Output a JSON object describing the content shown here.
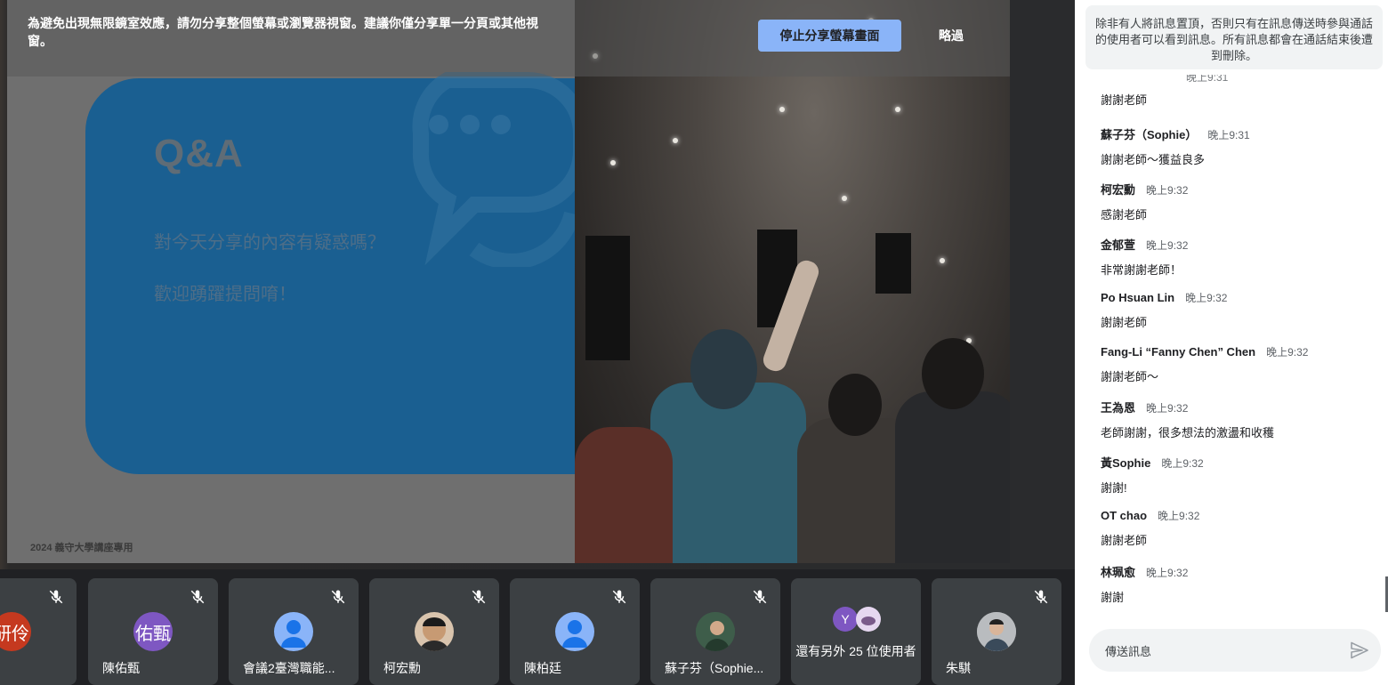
{
  "banner": {
    "warning": "為避免出現無限鏡室效應，請勿分享整個螢幕或瀏覽器視窗。建議你僅分享單一分頁或其他視窗。",
    "stop_share_label": "停止分享螢幕畫面",
    "skip_label": "略過"
  },
  "slide": {
    "title": "Q&A",
    "line1": "對今天分享的內容有疑惑嗎？",
    "line2": "歡迎踴躍提問唷！",
    "footer": "2024 義守大學講座專用",
    "card_color": "#1a5f91"
  },
  "participants": [
    {
      "name": "",
      "avatar_text": "研伶",
      "avatar_color": "#c5391f",
      "type": "initials"
    },
    {
      "name": "陳佑甄",
      "avatar_text": "佑甄",
      "avatar_color": "#7e57c2",
      "type": "initials"
    },
    {
      "name": "會議2臺灣職能...",
      "avatar_text": "",
      "avatar_color": "#8ab4f8",
      "type": "person-icon"
    },
    {
      "name": "柯宏勳",
      "avatar_text": "",
      "avatar_color": "#5a4a3e",
      "type": "photo"
    },
    {
      "name": "陳柏廷",
      "avatar_text": "",
      "avatar_color": "#8ab4f8",
      "type": "person-icon"
    },
    {
      "name": "蘇子芬（Sophie...",
      "avatar_text": "",
      "avatar_color": "#3e5d4a",
      "type": "photo"
    },
    {
      "name": "還有另外 25 位使用者",
      "avatar_text": "Y",
      "avatar_color": "#7e57c2",
      "type": "overflow"
    },
    {
      "name": "朱騏",
      "avatar_text": "",
      "avatar_color": "#9aa0a6",
      "type": "photo"
    }
  ],
  "chat": {
    "notice": "除非有人將訊息置頂，否則只有在訊息傳送時參與通話的使用者可以看到訊息。所有訊息都會在通話結束後遭到刪除。",
    "partial_top_time": "晚上9:31",
    "messages": [
      {
        "sender": "",
        "time": "",
        "text": "謝謝老師"
      },
      {
        "sender": "蘇子芬（Sophie）",
        "time": "晚上9:31",
        "text": "謝謝老師～獲益良多"
      },
      {
        "sender": "柯宏勳",
        "time": "晚上9:32",
        "text": "感謝老師"
      },
      {
        "sender": "金郁萱",
        "time": "晚上9:32",
        "text": "非常謝謝老師！"
      },
      {
        "sender": "Po Hsuan Lin",
        "time": "晚上9:32",
        "text": "謝謝老師"
      },
      {
        "sender": "Fang-Li “Fanny Chen” Chen",
        "time": "晚上9:32",
        "text": "謝謝老師～"
      },
      {
        "sender": "王為恩",
        "time": "晚上9:32",
        "text": "老師謝謝，很多想法的激盪和收穫"
      },
      {
        "sender": "黃Sophie",
        "time": "晚上9:32",
        "text": "謝謝!"
      },
      {
        "sender": "OT chao",
        "time": "晚上9:32",
        "text": "謝謝老師"
      },
      {
        "sender": "林珮愈",
        "time": "晚上9:32",
        "text": "謝謝"
      }
    ],
    "compose_placeholder": "傳送訊息",
    "send_icon": "send-icon"
  },
  "colors": {
    "accent": "#8ab4f8",
    "tile_bg": "#3c4043",
    "page_bg": "#202124"
  }
}
